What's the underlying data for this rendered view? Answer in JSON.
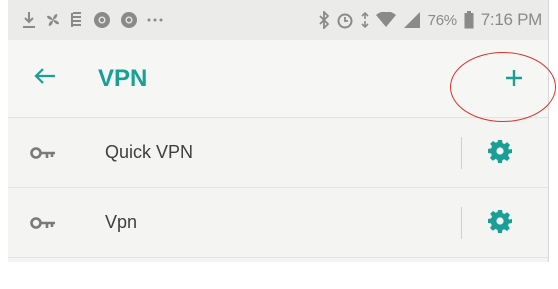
{
  "status_bar": {
    "battery_percent": "76%",
    "time": "7:16 PM",
    "icons": [
      "download-icon",
      "fan-icon",
      "app-icon",
      "chrome-icon",
      "chrome-icon",
      "more-icon",
      "bluetooth-icon",
      "alarm-icon",
      "data-icon",
      "wifi-icon",
      "signal-icon",
      "battery-icon"
    ]
  },
  "app_bar": {
    "title": "VPN",
    "back_icon": "arrow-left-icon",
    "add_icon": "plus-icon"
  },
  "vpn_list": {
    "items": [
      {
        "label": "Quick VPN",
        "icon": "key-icon",
        "action_icon": "gear-icon"
      },
      {
        "label": "Vpn",
        "icon": "key-icon",
        "action_icon": "gear-icon"
      }
    ]
  },
  "colors": {
    "accent": "#1a9e96",
    "annotation": "#d8342c",
    "icon_gray": "#7a7a7a"
  }
}
